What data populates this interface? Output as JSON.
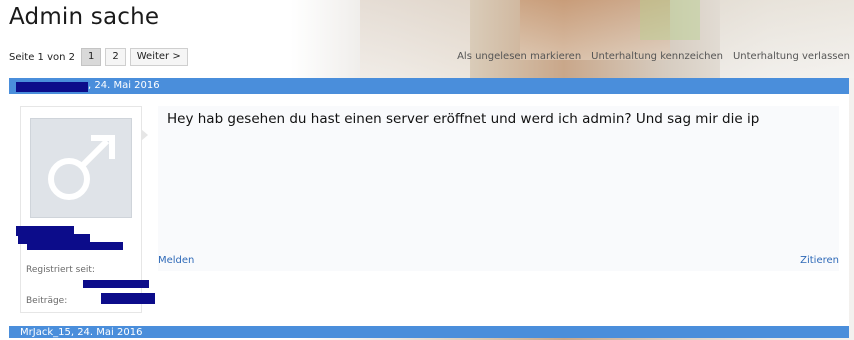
{
  "thread": {
    "title": "Admin sache"
  },
  "pager": {
    "page_text": "Seite 1 von 2",
    "pages": [
      "1",
      "2"
    ],
    "next_label": "Weiter >"
  },
  "thread_actions": {
    "mark_unread": "Als ungelesen markieren",
    "flag_conversation": "Unterhaltung kennzeichen",
    "leave_conversation": "Unterhaltung verlassen"
  },
  "posts": [
    {
      "date_label": ", 24. Mai 2016",
      "author_redacted": true,
      "registered_label": "Registriert seit:",
      "posts_label": "Beiträge:",
      "message": "Hey hab gesehen du hast einen server eröffnet und werd ich admin? Und sag mir die ip",
      "report_label": "Melden",
      "quote_label": "Zitieren"
    },
    {
      "header_label": "MrJack_15, 24. Mai 2016"
    }
  ],
  "colors": {
    "header_bar": "#4a8edb",
    "link": "#2f6ab8",
    "redaction": "#0c0c8a"
  },
  "icons": {
    "avatar": "male-symbol-icon"
  }
}
